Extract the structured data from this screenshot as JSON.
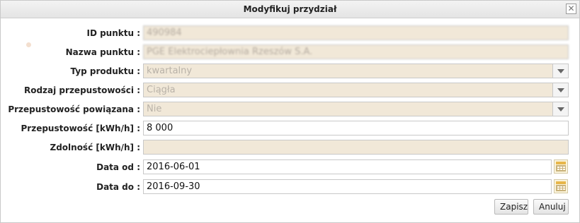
{
  "dialog": {
    "title": "Modyfikuj przydział",
    "close_glyph": "✕"
  },
  "fields": {
    "id_punktu": {
      "label": "ID punktu :",
      "value": "490984"
    },
    "nazwa_punktu": {
      "label": "Nazwa punktu :",
      "value": "PGE Elektrociepłownia Rzeszów S.A."
    },
    "typ_produktu": {
      "label": "Typ produktu :",
      "value": "kwartalny"
    },
    "rodzaj_przepustowosci": {
      "label": "Rodzaj przepustowości :",
      "value": "Ciągła"
    },
    "przepustowosc_powiazana": {
      "label": "Przepustowość powiązana :",
      "value": "Nie"
    },
    "przepustowosc": {
      "label": "Przepustowość [kWh/h] :",
      "value": "8 000"
    },
    "zdolnosc": {
      "label": "Zdolność [kWh/h] :",
      "value": ""
    },
    "data_od": {
      "label": "Data od :",
      "value": "2016-06-01"
    },
    "data_do": {
      "label": "Data do :",
      "value": "2016-09-30"
    }
  },
  "buttons": {
    "save": "Zapisz",
    "cancel": "Anuluj"
  },
  "icons": {
    "close": "close-icon",
    "dropdown": "chevron-down-icon",
    "calendar": "calendar-icon"
  }
}
